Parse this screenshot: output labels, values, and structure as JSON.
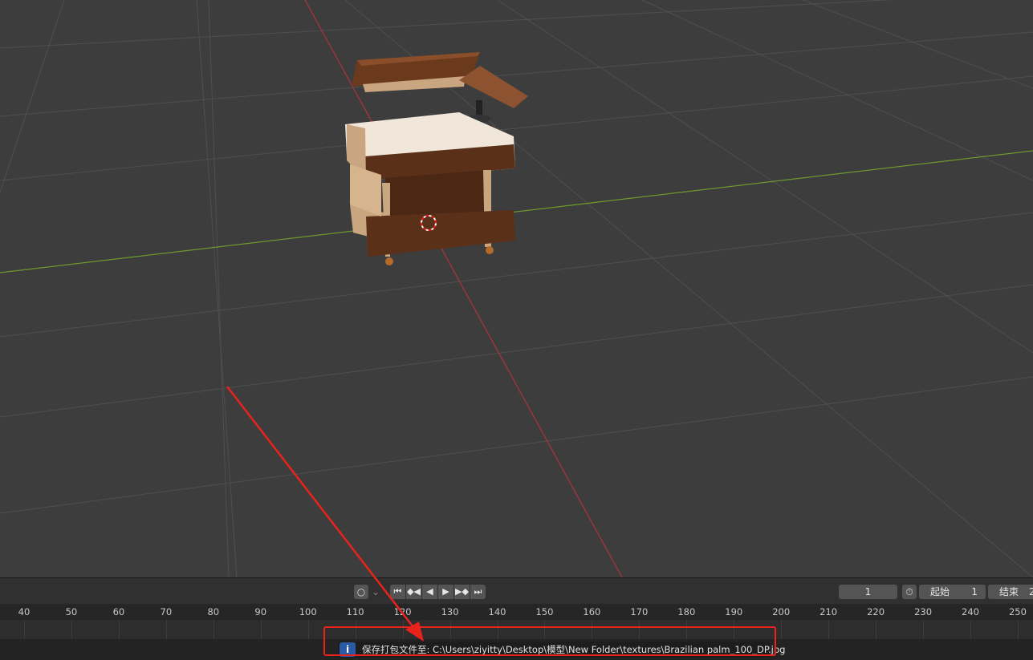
{
  "viewport": {
    "object_name": "wooden-cabinet-model"
  },
  "timeline": {
    "keying_icon": "record-circle-icon",
    "playback": {
      "jump_start": "⏮",
      "prev_key": "◆◀",
      "play_reverse": "◀",
      "play": "▶",
      "next_key": "▶◆",
      "jump_end": "⏭"
    },
    "current_frame": "1",
    "start_label": "起始",
    "start_value": "1",
    "end_label": "结束",
    "end_value": "2",
    "ruler_ticks": [
      "40",
      "50",
      "60",
      "70",
      "80",
      "90",
      "100",
      "110",
      "120",
      "130",
      "140",
      "150",
      "160",
      "170",
      "180",
      "190",
      "200",
      "210",
      "220",
      "230",
      "240",
      "250"
    ]
  },
  "status": {
    "icon": "info-icon",
    "message": "保存打包文件至: C:\\Users\\ziyitty\\Desktop\\模型\\New Folder\\textures\\Brazilian palm_100_DP.jpg"
  },
  "colors": {
    "accent_red": "#e8231c",
    "x_axis": "#a8333d",
    "y_axis": "#6c9a2e",
    "info_blue": "#2a5aa6"
  }
}
